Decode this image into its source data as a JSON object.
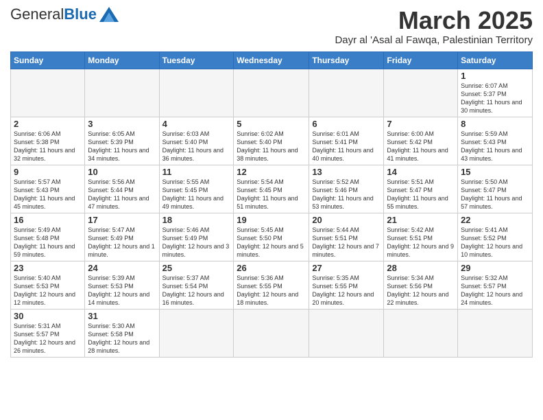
{
  "logo": {
    "general": "General",
    "blue": "Blue"
  },
  "title": {
    "month": "March 2025",
    "subtitle": "Dayr al 'Asal al Fawqa, Palestinian Territory"
  },
  "headers": [
    "Sunday",
    "Monday",
    "Tuesday",
    "Wednesday",
    "Thursday",
    "Friday",
    "Saturday"
  ],
  "weeks": [
    [
      {
        "day": "",
        "info": ""
      },
      {
        "day": "",
        "info": ""
      },
      {
        "day": "",
        "info": ""
      },
      {
        "day": "",
        "info": ""
      },
      {
        "day": "",
        "info": ""
      },
      {
        "day": "",
        "info": ""
      },
      {
        "day": "1",
        "info": "Sunrise: 6:07 AM\nSunset: 5:37 PM\nDaylight: 11 hours and 30 minutes."
      }
    ],
    [
      {
        "day": "2",
        "info": "Sunrise: 6:06 AM\nSunset: 5:38 PM\nDaylight: 11 hours and 32 minutes."
      },
      {
        "day": "3",
        "info": "Sunrise: 6:05 AM\nSunset: 5:39 PM\nDaylight: 11 hours and 34 minutes."
      },
      {
        "day": "4",
        "info": "Sunrise: 6:03 AM\nSunset: 5:40 PM\nDaylight: 11 hours and 36 minutes."
      },
      {
        "day": "5",
        "info": "Sunrise: 6:02 AM\nSunset: 5:40 PM\nDaylight: 11 hours and 38 minutes."
      },
      {
        "day": "6",
        "info": "Sunrise: 6:01 AM\nSunset: 5:41 PM\nDaylight: 11 hours and 40 minutes."
      },
      {
        "day": "7",
        "info": "Sunrise: 6:00 AM\nSunset: 5:42 PM\nDaylight: 11 hours and 41 minutes."
      },
      {
        "day": "8",
        "info": "Sunrise: 5:59 AM\nSunset: 5:43 PM\nDaylight: 11 hours and 43 minutes."
      }
    ],
    [
      {
        "day": "9",
        "info": "Sunrise: 5:57 AM\nSunset: 5:43 PM\nDaylight: 11 hours and 45 minutes."
      },
      {
        "day": "10",
        "info": "Sunrise: 5:56 AM\nSunset: 5:44 PM\nDaylight: 11 hours and 47 minutes."
      },
      {
        "day": "11",
        "info": "Sunrise: 5:55 AM\nSunset: 5:45 PM\nDaylight: 11 hours and 49 minutes."
      },
      {
        "day": "12",
        "info": "Sunrise: 5:54 AM\nSunset: 5:45 PM\nDaylight: 11 hours and 51 minutes."
      },
      {
        "day": "13",
        "info": "Sunrise: 5:52 AM\nSunset: 5:46 PM\nDaylight: 11 hours and 53 minutes."
      },
      {
        "day": "14",
        "info": "Sunrise: 5:51 AM\nSunset: 5:47 PM\nDaylight: 11 hours and 55 minutes."
      },
      {
        "day": "15",
        "info": "Sunrise: 5:50 AM\nSunset: 5:47 PM\nDaylight: 11 hours and 57 minutes."
      }
    ],
    [
      {
        "day": "16",
        "info": "Sunrise: 5:49 AM\nSunset: 5:48 PM\nDaylight: 11 hours and 59 minutes."
      },
      {
        "day": "17",
        "info": "Sunrise: 5:47 AM\nSunset: 5:49 PM\nDaylight: 12 hours and 1 minute."
      },
      {
        "day": "18",
        "info": "Sunrise: 5:46 AM\nSunset: 5:49 PM\nDaylight: 12 hours and 3 minutes."
      },
      {
        "day": "19",
        "info": "Sunrise: 5:45 AM\nSunset: 5:50 PM\nDaylight: 12 hours and 5 minutes."
      },
      {
        "day": "20",
        "info": "Sunrise: 5:44 AM\nSunset: 5:51 PM\nDaylight: 12 hours and 7 minutes."
      },
      {
        "day": "21",
        "info": "Sunrise: 5:42 AM\nSunset: 5:51 PM\nDaylight: 12 hours and 9 minutes."
      },
      {
        "day": "22",
        "info": "Sunrise: 5:41 AM\nSunset: 5:52 PM\nDaylight: 12 hours and 10 minutes."
      }
    ],
    [
      {
        "day": "23",
        "info": "Sunrise: 5:40 AM\nSunset: 5:53 PM\nDaylight: 12 hours and 12 minutes."
      },
      {
        "day": "24",
        "info": "Sunrise: 5:39 AM\nSunset: 5:53 PM\nDaylight: 12 hours and 14 minutes."
      },
      {
        "day": "25",
        "info": "Sunrise: 5:37 AM\nSunset: 5:54 PM\nDaylight: 12 hours and 16 minutes."
      },
      {
        "day": "26",
        "info": "Sunrise: 5:36 AM\nSunset: 5:55 PM\nDaylight: 12 hours and 18 minutes."
      },
      {
        "day": "27",
        "info": "Sunrise: 5:35 AM\nSunset: 5:55 PM\nDaylight: 12 hours and 20 minutes."
      },
      {
        "day": "28",
        "info": "Sunrise: 5:34 AM\nSunset: 5:56 PM\nDaylight: 12 hours and 22 minutes."
      },
      {
        "day": "29",
        "info": "Sunrise: 5:32 AM\nSunset: 5:57 PM\nDaylight: 12 hours and 24 minutes."
      }
    ],
    [
      {
        "day": "30",
        "info": "Sunrise: 5:31 AM\nSunset: 5:57 PM\nDaylight: 12 hours and 26 minutes."
      },
      {
        "day": "31",
        "info": "Sunrise: 5:30 AM\nSunset: 5:58 PM\nDaylight: 12 hours and 28 minutes."
      },
      {
        "day": "",
        "info": ""
      },
      {
        "day": "",
        "info": ""
      },
      {
        "day": "",
        "info": ""
      },
      {
        "day": "",
        "info": ""
      },
      {
        "day": "",
        "info": ""
      }
    ]
  ]
}
